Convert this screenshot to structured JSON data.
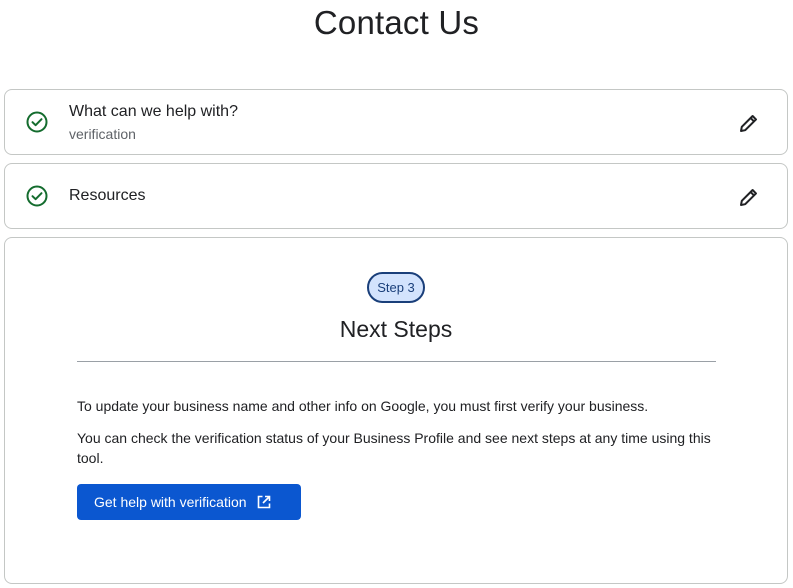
{
  "page": {
    "title": "Contact Us"
  },
  "steps": [
    {
      "heading": "What can we help with?",
      "subtext": "verification",
      "status_icon": "check-circle-icon",
      "action_icon": "pencil-icon"
    },
    {
      "heading": "Resources",
      "status_icon": "check-circle-icon",
      "action_icon": "pencil-icon"
    }
  ],
  "current_step": {
    "badge": "Step 3",
    "title": "Next Steps",
    "paragraphs": [
      "To update your business name and other info on Google, you must first verify your business.",
      "You can check the verification status of your Business Profile and see next steps at any time using this tool."
    ],
    "button_label": "Get help with verification",
    "button_icon": "open-in-new-icon"
  },
  "colors": {
    "check": "#146c2e",
    "badge_bg": "#d3e3fd",
    "badge_border": "#1a3f7a",
    "button_bg": "#0b57d0"
  }
}
